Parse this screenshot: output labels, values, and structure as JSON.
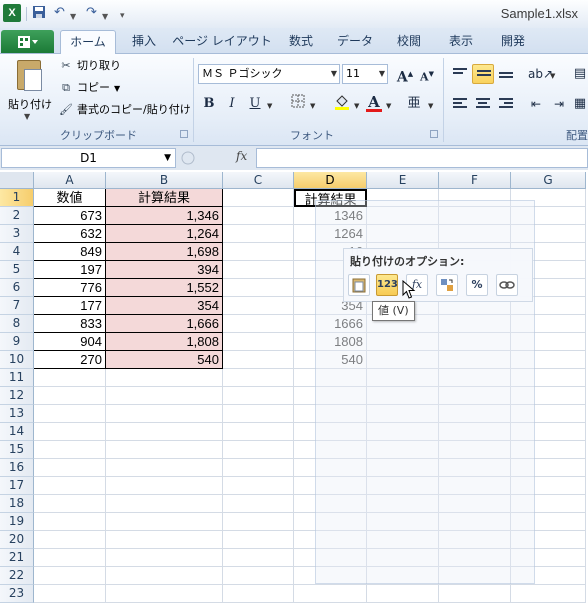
{
  "window": {
    "title": "Sample1.xlsx"
  },
  "quick_access": {
    "save_icon": "save-icon",
    "undo_icon": "undo-icon",
    "redo_icon": "redo-icon"
  },
  "tabs": {
    "file": "",
    "items": [
      "ホーム",
      "挿入",
      "ページ レイアウト",
      "数式",
      "データ",
      "校閲",
      "表示",
      "開発"
    ],
    "active_index": 0
  },
  "ribbon": {
    "clipboard": {
      "paste_label": "貼り付け",
      "cut_label": "切り取り",
      "copy_label": "コピー",
      "format_painter_label": "書式のコピー/貼り付け",
      "group_label": "クリップボード"
    },
    "font": {
      "font_name": "ＭＳ Ｐゴシック",
      "font_size": "11",
      "bold": "B",
      "italic": "I",
      "underline": "U",
      "group_label": "フォント"
    },
    "alignment": {
      "group_label": "配置"
    }
  },
  "formula_bar": {
    "name_box": "D1",
    "fx": "fx",
    "formula": ""
  },
  "sheet": {
    "columns": [
      "A",
      "B",
      "C",
      "D",
      "E",
      "F",
      "G"
    ],
    "selected_column": "D",
    "rows": [
      "1",
      "2",
      "3",
      "4",
      "5",
      "6",
      "7",
      "8",
      "9",
      "10",
      "11",
      "12",
      "13",
      "14",
      "15",
      "16",
      "17",
      "18",
      "19",
      "20",
      "21",
      "22",
      "23"
    ],
    "selected_row": "1",
    "header_a": "数値",
    "header_b": "計算結果",
    "header_d": "計算結果",
    "col_a": [
      "673",
      "632",
      "849",
      "197",
      "776",
      "177",
      "833",
      "904",
      "270"
    ],
    "col_b": [
      "1,346",
      "1,264",
      "1,698",
      "394",
      "1,552",
      "354",
      "1,666",
      "1,808",
      "540"
    ],
    "col_d": [
      "1346",
      "1264",
      "16",
      "3",
      "15",
      "354",
      "1666",
      "1808",
      "540"
    ]
  },
  "paste_options": {
    "title": "貼り付けのオプション:",
    "buttons": [
      "paste-icon",
      "123",
      "fx",
      "transpose-icon",
      "%",
      "link-icon"
    ],
    "tooltip": "値 (V)"
  },
  "colors": {
    "pink_fill": "#f4d9d9",
    "file_tab": "#1b7a36",
    "selection": "#f6cd6c"
  }
}
